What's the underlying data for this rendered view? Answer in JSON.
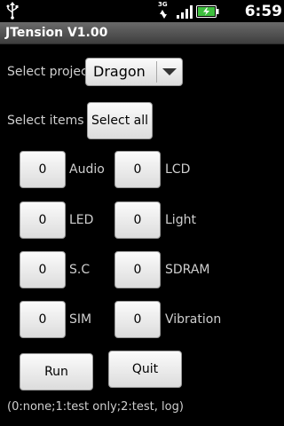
{
  "status_bar": {
    "network": "3G",
    "time": "6:59 PM",
    "icons": [
      "usb-icon",
      "network-3g-icon",
      "signal-icon",
      "battery-charging-icon"
    ]
  },
  "title_bar": {
    "title": "JTension V1.00"
  },
  "project": {
    "label": "Select project",
    "selected": "Dragon"
  },
  "items": {
    "label": "Select items",
    "select_all_label": "Select all",
    "list": [
      {
        "name": "Audio",
        "value": "0"
      },
      {
        "name": "LCD",
        "value": "0"
      },
      {
        "name": "LED",
        "value": "0"
      },
      {
        "name": "Light",
        "value": "0"
      },
      {
        "name": "S.C",
        "value": "0"
      },
      {
        "name": "SDRAM",
        "value": "0"
      },
      {
        "name": "SIM",
        "value": "0"
      },
      {
        "name": "Vibration",
        "value": "0"
      }
    ]
  },
  "actions": {
    "run_label": "Run",
    "quit_label": "Quit"
  },
  "footer": {
    "note": "(0:none;1:test only;2:test, log)"
  }
}
